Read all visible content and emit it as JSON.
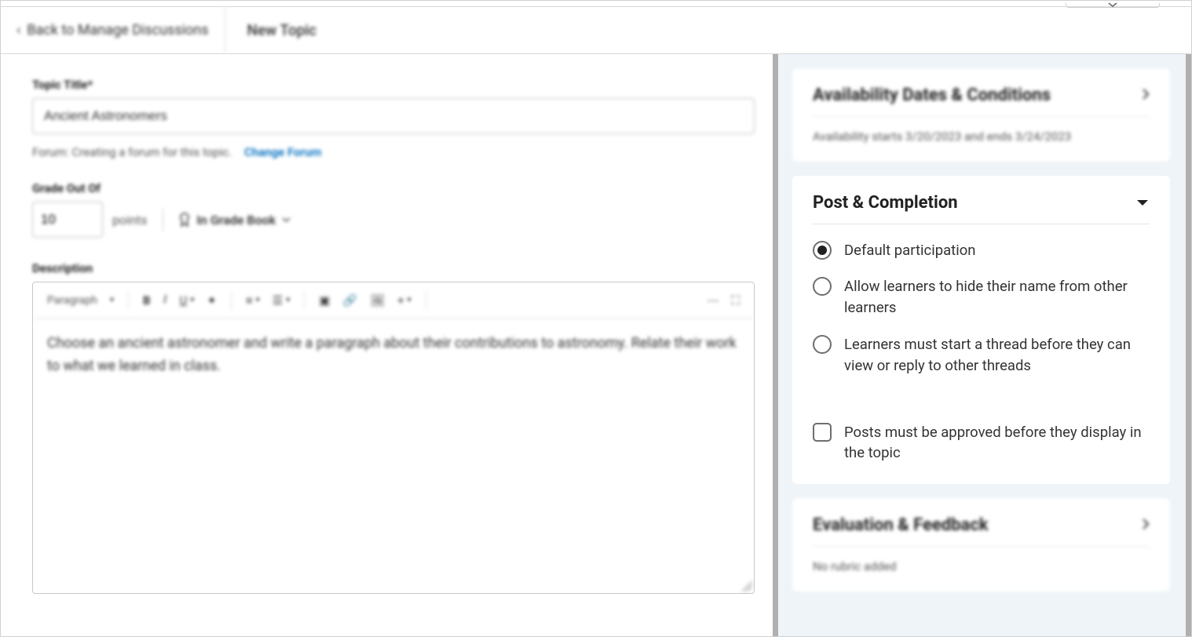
{
  "header": {
    "back_label": "Back to Manage Discussions",
    "page_title": "New Topic"
  },
  "main": {
    "title_label": "Topic Title*",
    "title_value": "Ancient Astronomers",
    "forum_text": "Forum: Creating a forum for this topic.",
    "change_forum": "Change Forum",
    "grade_label": "Grade Out Of",
    "grade_value": "10",
    "points_label": "points",
    "gradebook_label": "In Grade Book",
    "description_label": "Description",
    "rte": {
      "paragraph": "Paragraph",
      "content": "Choose an ancient astronomer and write a paragraph about their contributions to astronomy. Relate their work to what we learned in class."
    }
  },
  "sidebar": {
    "availability": {
      "title": "Availability Dates & Conditions",
      "summary": "Availability starts 3/20/2023 and ends 3/24/2023"
    },
    "post": {
      "title": "Post & Completion",
      "opt_default": "Default participation",
      "opt_hide": "Allow learners to hide their name from other learners",
      "opt_thread": "Learners must start a thread before they can view or reply to other threads",
      "opt_approve": "Posts must be approved before they display in the topic"
    },
    "evaluation": {
      "title": "Evaluation & Feedback",
      "summary": "No rubric added"
    }
  }
}
